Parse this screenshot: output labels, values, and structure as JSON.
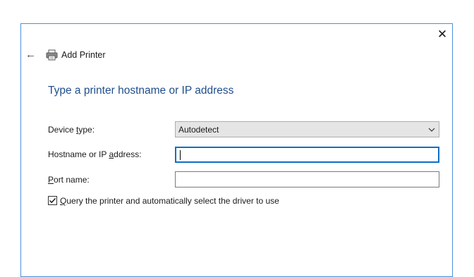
{
  "window": {
    "close_glyph": "✕",
    "back_glyph": "←",
    "title": "Add Printer"
  },
  "form": {
    "heading": "Type a printer hostname or IP address",
    "device_type": {
      "label_pre": "Device ",
      "label_ul": "t",
      "label_post": "ype:",
      "value": "Autodetect"
    },
    "hostname": {
      "label_pre": "Hostname or IP ",
      "label_ul": "a",
      "label_post": "ddress:",
      "value": ""
    },
    "port": {
      "label_ul": "P",
      "label_post": "ort name:",
      "value": ""
    },
    "query_driver": {
      "checked": true,
      "label_ul": "Q",
      "label_post": "uery the printer and automatically select the driver to use"
    }
  },
  "colors": {
    "accent": "#0e6fc5",
    "heading": "#1f4e8c",
    "dialog_border": "#4a90d9"
  },
  "icons": [
    "close-icon",
    "back-arrow-icon",
    "printer-icon",
    "chevron-down-icon",
    "checkmark-icon"
  ]
}
